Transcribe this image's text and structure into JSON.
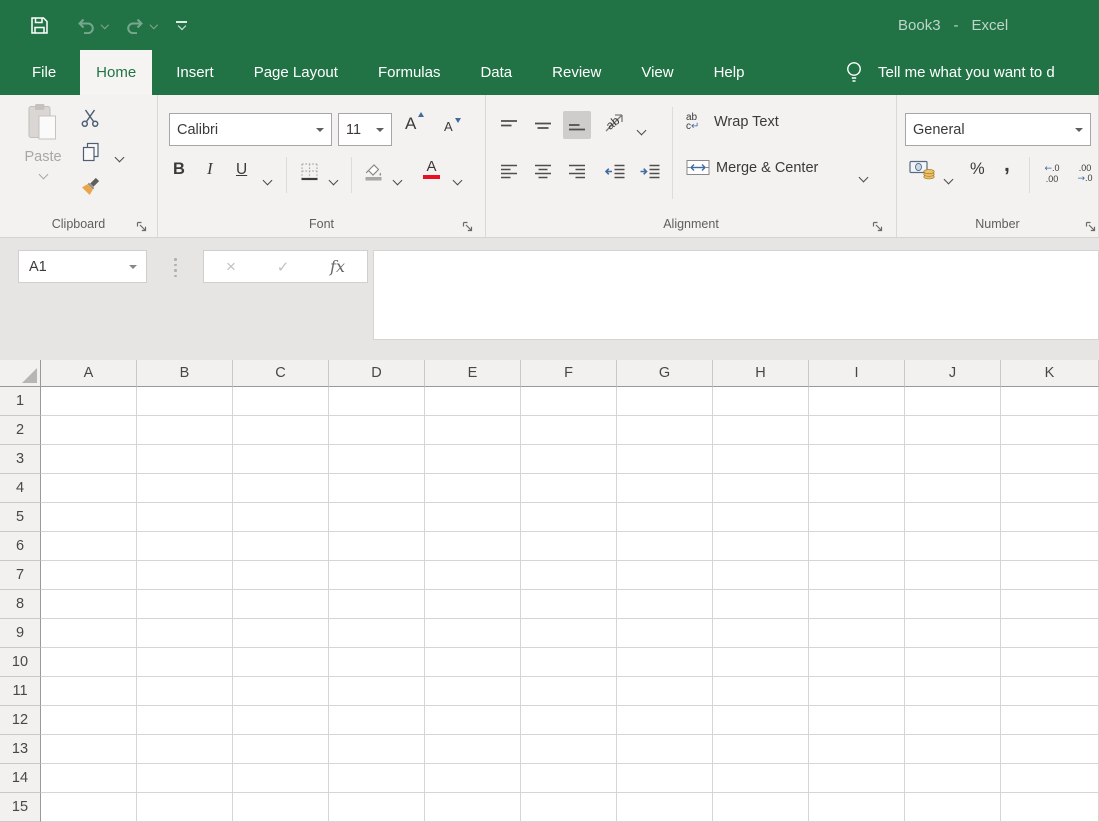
{
  "colors": {
    "brand_green": "#217346",
    "active_tab_text": "#217346",
    "font_color_bar_red": "#e81123",
    "accent_blue": "#3f6b9e",
    "selected_control_bg": "#cfcdcb",
    "ribbon_bg": "#f3f2f1",
    "chrome_bg": "#e6e5e3",
    "gridline": "#d7d5d3"
  },
  "titlebar": {
    "workbook": "Book3",
    "separator": "-",
    "app": "Excel",
    "quick_access_icons": [
      "save",
      "undo",
      "redo",
      "customize-quick-access-toolbar"
    ]
  },
  "tabs": [
    {
      "label": "File",
      "active": false
    },
    {
      "label": "Home",
      "active": true
    },
    {
      "label": "Insert",
      "active": false
    },
    {
      "label": "Page Layout",
      "active": false
    },
    {
      "label": "Formulas",
      "active": false
    },
    {
      "label": "Data",
      "active": false
    },
    {
      "label": "Review",
      "active": false
    },
    {
      "label": "View",
      "active": false
    },
    {
      "label": "Help",
      "active": false
    }
  ],
  "search": {
    "lightbulb_icon": "lightbulb",
    "tellme": "Tell me what you want to d"
  },
  "ribbon": {
    "clipboard": {
      "label": "Clipboard",
      "paste_label": "Paste"
    },
    "font": {
      "label": "Font",
      "font_name": "Calibri",
      "font_size": "11",
      "bold": "B",
      "italic": "I",
      "underline": "U",
      "grow": "A",
      "shrink": "A",
      "color_letter": "A"
    },
    "alignment": {
      "label": "Alignment",
      "orientation_text": "ab",
      "wrap_ab": "ab",
      "wrap_c": "c",
      "wrap_text": "Wrap Text",
      "merge_center": "Merge & Center"
    },
    "number": {
      "label": "Number",
      "format": "General",
      "percent": "%",
      "comma": ",",
      "inc_arrow": "←",
      "inc_top": ".0",
      "inc_bottom": ".00",
      "dec_top": ".00",
      "dec_arrow": "→",
      "dec_bottom": ".0"
    }
  },
  "formula_bar": {
    "name_box": "A1",
    "cancel": "×",
    "enter": "✓",
    "function": "fx",
    "value": ""
  },
  "grid": {
    "columns": [
      "A",
      "B",
      "C",
      "D",
      "E",
      "F",
      "G",
      "H",
      "I",
      "J",
      "K"
    ],
    "rows": [
      "1",
      "2",
      "3",
      "4",
      "5",
      "6",
      "7",
      "8",
      "9",
      "10",
      "11",
      "12",
      "13",
      "14",
      "15"
    ]
  }
}
